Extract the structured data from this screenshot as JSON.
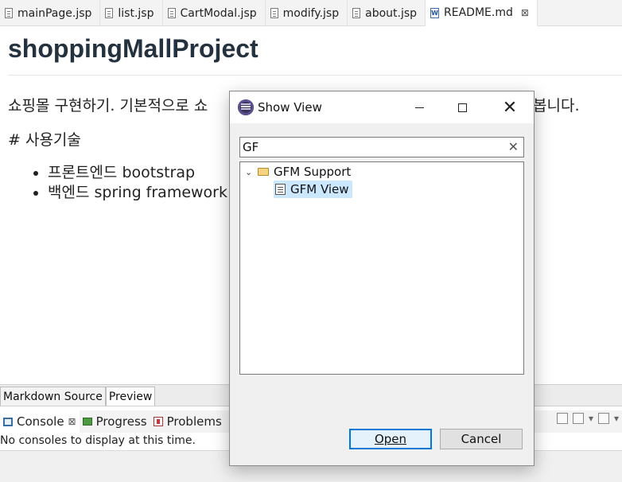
{
  "editor_tabs": [
    {
      "label": "mainPage.jsp",
      "icon": "file-icon"
    },
    {
      "label": "list.jsp",
      "icon": "file-icon"
    },
    {
      "label": "CartModal.jsp",
      "icon": "file-icon"
    },
    {
      "label": "modify.jsp",
      "icon": "file-icon"
    },
    {
      "label": "about.jsp",
      "icon": "file-icon"
    },
    {
      "label": "README.md",
      "icon": "word-file-icon",
      "active": true,
      "close": "⊠"
    }
  ],
  "document": {
    "title": "shoppingMallProject",
    "paragraph_start": "쇼핑몰 구현하기. 기본적으로 쇼",
    "paragraph_end": "봅니다.",
    "heading": "# 사용기술",
    "bullets": [
      "프론트엔드 bootstrap",
      "백엔드 spring framework M"
    ]
  },
  "markdown_tabs": {
    "source": "Markdown Source",
    "preview": "Preview"
  },
  "console_panel": {
    "tabs": {
      "console": "Console",
      "console_close": "⊠",
      "progress": "Progress",
      "problems": "Problems"
    },
    "message": "No consoles to display at this time."
  },
  "dialog": {
    "title": "Show View",
    "filter_value": "GF",
    "clear_symbol": "✕",
    "tree": {
      "folder": "GFM Support",
      "view": "GFM View"
    },
    "open_label": "Open",
    "cancel_label": "Cancel",
    "window_close": "✕"
  },
  "colors": {
    "selection": "#cce8ff",
    "default_button_border": "#0078d7",
    "title_text": "#24313f"
  }
}
